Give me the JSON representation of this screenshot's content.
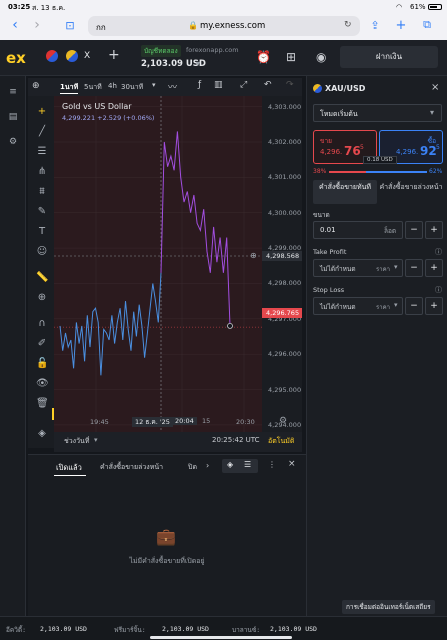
{
  "status_bar": {
    "time": "03:25",
    "date": "ส. 13 ธ.ค.",
    "battery": "61%"
  },
  "safari": {
    "tab_text": "กก",
    "url": "my.exness.com"
  },
  "app_header": {
    "logo": "ex",
    "tab_label": "X",
    "account_badge": "บัญชีทดลอง",
    "account_server": "forexonapp.com",
    "balance": "2,103.09 USD",
    "deposit_label": "ฝากเงิน"
  },
  "chart_toolbar": {
    "timeframes": [
      "1นาที",
      "5นาที",
      "4h",
      "30นาที"
    ]
  },
  "chart": {
    "symbol_title": "Gold vs US Dollar",
    "quote_line": "4,299.221 +2.529 (+0.06%)",
    "bid_tag": "4,298.568",
    "ask_tag": "4,296.765",
    "date_tag": "12 ธ.ค. '25",
    "time_tag": "20:04",
    "time_tag2": "15",
    "time_zone_label": "ช่วงวันที่",
    "clock": "20:25:42 UTC",
    "auto_label": "อัตโนมัติ",
    "hide_btn": "1"
  },
  "chart_data": {
    "type": "line",
    "y_ticks": [
      4303.0,
      4302.0,
      4301.0,
      4300.0,
      4299.0,
      4298.0,
      4297.0,
      4296.0,
      4295.0,
      4294.0
    ],
    "y_tick_labels": [
      "4,303.000",
      "4,302.000",
      "4,301.000",
      "4,300.000",
      "4,299.000",
      "4,298.000",
      "4,297.000",
      "4,296.000",
      "4,295.000",
      "4,294.000"
    ],
    "x_tick_labels": [
      "19:45",
      "20:30"
    ],
    "ylim": [
      4293.8,
      4303.3
    ],
    "series": [
      {
        "values": [
          4296.8,
          4296.1,
          4296.6,
          4296.2,
          4296.4,
          4295.6,
          4296.9,
          4296.3,
          4296.8,
          4295.8,
          4297.1,
          4296.2,
          4297.2,
          4297.3,
          4296.9,
          4295.4,
          4296.7,
          4296.6,
          4296.4,
          4297.1,
          4296.3,
          4296.9,
          4297.3,
          4296.4,
          4297.5,
          4296.7,
          4296.1,
          4297.2,
          4296.5,
          4297.4,
          4296.8,
          4295.9,
          4296.6,
          4297.3,
          4298.0,
          4297.5,
          4296.9,
          4298.3
        ],
        "color": "#4a8fe0"
      },
      {
        "values": [
          4298.3,
          4302.0,
          4301.3,
          4301.6,
          4301.2,
          4302.3,
          4301.0,
          4300.3,
          4300.6,
          4300.0,
          4300.5,
          4299.7,
          4299.5,
          4300.1,
          4298.9,
          4298.3,
          4299.6,
          4298.6,
          4299.3,
          4298.3,
          4299.3,
          4296.8
        ],
        "color": "#a24ee0"
      }
    ]
  },
  "order_panel": {
    "symbol": "XAU/USD",
    "mode": "โหมดเริ่มต้น",
    "sell_label": "ขาย",
    "sell_price_main": "4,296.",
    "sell_price_big": "76",
    "sell_price_sup": "5",
    "spread": "0.18 USD",
    "buy_label": "ซื้อ",
    "buy_price_main": "4,296.",
    "buy_price_big": "92",
    "buy_price_sup": "5",
    "sell_pct": "38%",
    "buy_pct": "62%",
    "market_order": "คำสั่งซื้อขายทันที",
    "pending_order": "คำสั่งซื้อขายล่วงหน้า",
    "volume_label": "ขนาด",
    "volume_value": "0.01",
    "volume_unit": "ล็อต",
    "tp_label": "Take Profit",
    "tp_value": "ไม่ได้กำหนด",
    "tp_unit": "ราคา",
    "sl_label": "Stop Loss",
    "sl_value": "ไม่ได้กำหนด",
    "sl_unit": "ราคา"
  },
  "bottom_panel": {
    "tab_open": "เปิดแล้ว",
    "tab_pending": "คำสั่งซื้อขายล่วงหน้า",
    "tab_closed": "ปิด",
    "empty_text": "ไม่มีคำสั่งซื้อขายที่เปิดอยู่",
    "connection": "การเชื่อมต่ออินเทอร์เน็ตเสถียร"
  },
  "footer": {
    "equity_label": "อีควิตี้:",
    "equity_value": "2,103.09 USD",
    "free_margin_label": "ฟรีมาร์จิ้น:",
    "free_margin_value": "2,103.09 USD",
    "balance_label": "บาลานซ์:",
    "balance_value": "2,103.09 USD"
  },
  "colors": {
    "sell": "#e5484d",
    "buy": "#3b82f6",
    "accent": "#ffcf27",
    "chart_bg": "#2b1a1e"
  }
}
